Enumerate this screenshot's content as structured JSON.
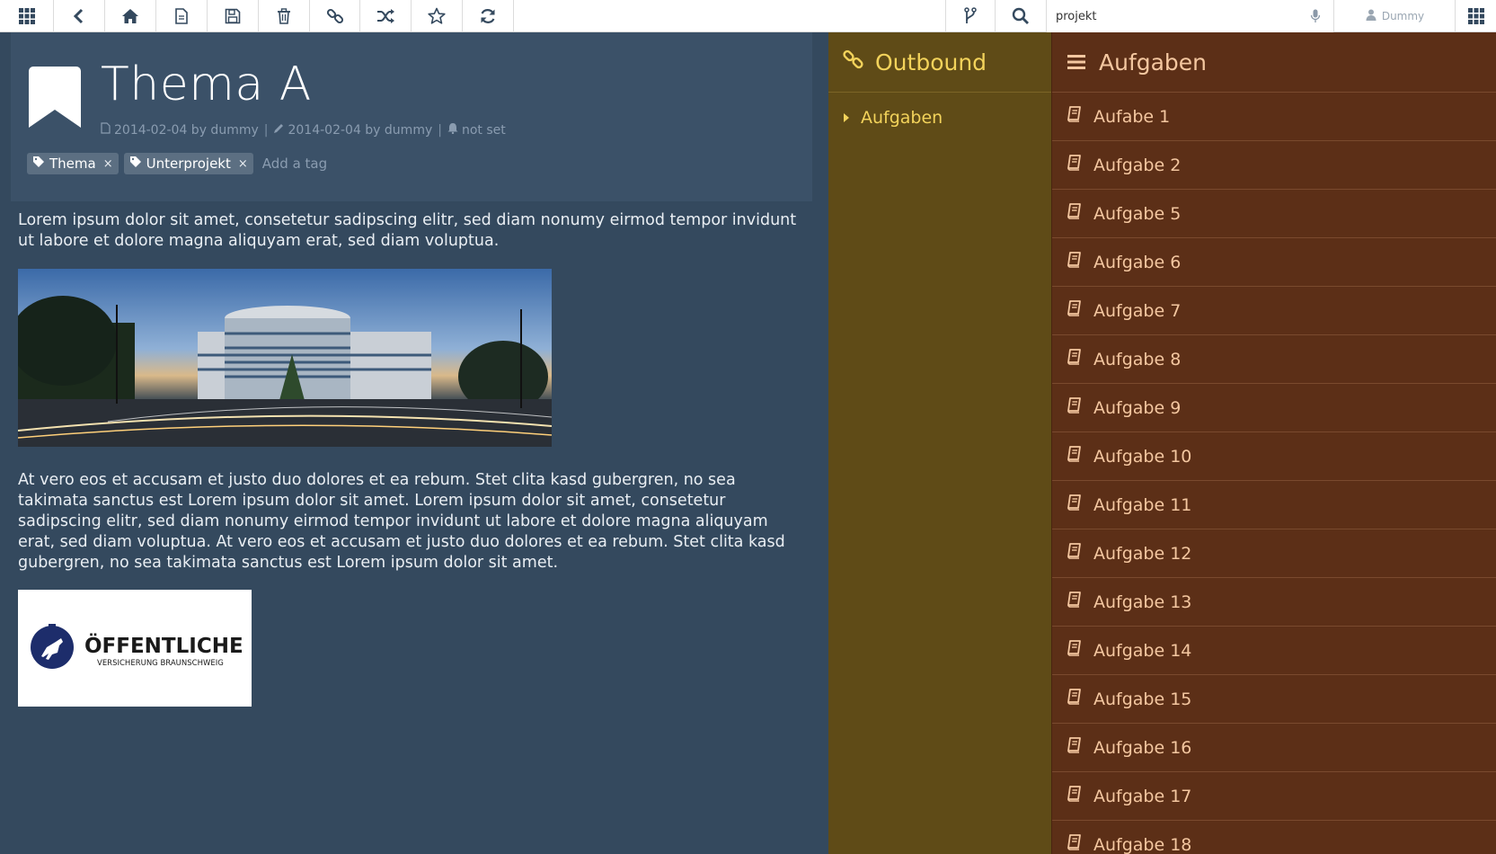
{
  "toolbar": {
    "buttons": [
      "apps-icon",
      "back-icon",
      "home-icon",
      "file-icon",
      "save-icon",
      "trash-icon",
      "link-icon",
      "shuffle-icon",
      "star-icon",
      "refresh-icon"
    ],
    "right_buttons": [
      "branch-icon",
      "search-icon"
    ],
    "search_value": "projekt",
    "user_name": "Dummy"
  },
  "page": {
    "title": "Thema A",
    "created": "2014-02-04 by dummy",
    "edited": "2014-02-04 by dummy",
    "reminder": "not set",
    "sep": "|",
    "tags": [
      "Thema",
      "Unterprojekt"
    ],
    "tag_remove": "×",
    "add_tag_placeholder": "Add a tag",
    "paragraph1": "Lorem ipsum dolor sit amet, consetetur sadipscing elitr, sed diam nonumy eirmod tempor invidunt ut labore et dolore magna aliquyam erat, sed diam voluptua.",
    "paragraph2": "At vero eos et accusam et justo duo dolores et ea rebum. Stet clita kasd gubergren, no sea takimata sanctus est Lorem ipsum dolor sit amet. Lorem ipsum dolor sit amet, consetetur sadipscing elitr, sed diam nonumy eirmod tempor invidunt ut labore et dolore magna aliquyam erat, sed diam voluptua. At vero eos et accusam et justo duo dolores et ea rebum. Stet clita kasd gubergren, no sea takimata sanctus est Lorem ipsum dolor sit amet.",
    "logo_text": "ÖFFENTLICHE",
    "logo_subtext": "VERSICHERUNG BRAUNSCHWEIG"
  },
  "outbound": {
    "title": "Outbound",
    "items": [
      "Aufgaben"
    ]
  },
  "tasks": {
    "title": "Aufgaben",
    "items": [
      "Aufabe 1",
      "Aufgabe 2",
      "Aufgabe 5",
      "Aufgabe 6",
      "Aufgabe 7",
      "Aufgabe 8",
      "Aufgabe 9",
      "Aufgabe 10",
      "Aufgabe 11",
      "Aufgabe 12",
      "Aufgabe 13",
      "Aufgabe 14",
      "Aufgabe 15",
      "Aufgabe 16",
      "Aufgabe 17",
      "Aufgabe 18"
    ]
  },
  "colors": {
    "main_bg": "#34495e",
    "outbound_bg": "#5f4b17",
    "outbound_text": "#f3d35b",
    "tasks_bg": "#5c2f17",
    "tasks_text": "#f4c7a0"
  }
}
